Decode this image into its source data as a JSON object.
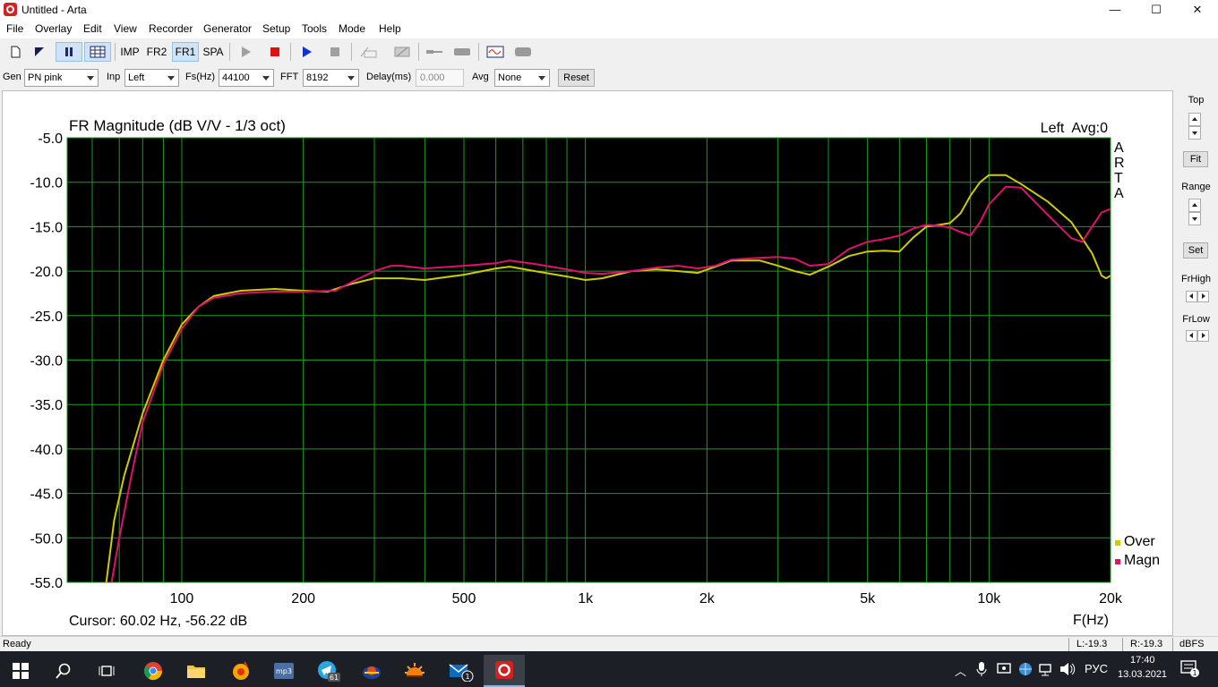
{
  "window": {
    "title": "Untitled - Arta",
    "min_glyph": "—",
    "max_glyph": "☐",
    "close_glyph": "✕"
  },
  "menu": [
    "File",
    "Overlay",
    "Edit",
    "View",
    "Recorder",
    "Generator",
    "Setup",
    "Tools",
    "Mode",
    "Help"
  ],
  "toolbar": {
    "imp": "IMP",
    "fr2": "FR2",
    "fr1": "FR1",
    "spa": "SPA"
  },
  "params": {
    "gen_label": "Gen",
    "gen_value": "PN pink",
    "inp_label": "Inp",
    "inp_value": "Left",
    "fs_label": "Fs(Hz)",
    "fs_value": "44100",
    "fft_label": "FFT",
    "fft_value": "8192",
    "delay_label": "Delay(ms)",
    "delay_value": "0.000",
    "avg_label": "Avg",
    "avg_value": "None",
    "reset_label": "Reset"
  },
  "right_panel": {
    "top": "Top",
    "fit": "Fit",
    "range": "Range",
    "set": "Set",
    "frhigh": "FrHigh",
    "frlow": "FrLow"
  },
  "status": {
    "ready": "Ready",
    "left_level": "L:-19.3",
    "right_level": "R:-19.3",
    "units": "dBFS"
  },
  "taskbar": {
    "time": "17:40",
    "date": "13.03.2021",
    "lang": "РУС",
    "telegram_badge": "61",
    "mail_badge": "1"
  },
  "chart_data": {
    "type": "line",
    "title": "FR Magnitude (dB V/V - 1/3 oct)",
    "channel_info": "Left  Avg:0",
    "watermark": "ARTA",
    "xlabel": "F(Hz)",
    "cursor_readout": "Cursor: 60.02 Hz, -56.22 dB",
    "x_scale": "log",
    "xlim": [
      52,
      20000
    ],
    "ylim": [
      -55,
      -5
    ],
    "grid": true,
    "x_tick_labels": [
      "100",
      "200",
      "500",
      "1k",
      "2k",
      "5k",
      "10k",
      "20k"
    ],
    "x_tick_values": [
      100,
      200,
      500,
      1000,
      2000,
      5000,
      10000,
      20000
    ],
    "y_tick_labels": [
      "-5.0",
      "-10.0",
      "-15.0",
      "-20.0",
      "-25.0",
      "-30.0",
      "-35.0",
      "-40.0",
      "-45.0",
      "-50.0",
      "-55.0"
    ],
    "y_tick_values": [
      -5,
      -10,
      -15,
      -20,
      -25,
      -30,
      -35,
      -40,
      -45,
      -50,
      -55
    ],
    "legend_position": "bottom-right",
    "series": [
      {
        "name": "Over",
        "color": "#cccc00",
        "points": [
          [
            65,
            -55
          ],
          [
            68,
            -48
          ],
          [
            72,
            -43
          ],
          [
            80,
            -36
          ],
          [
            90,
            -30
          ],
          [
            100,
            -26
          ],
          [
            110,
            -24
          ],
          [
            120,
            -22.8
          ],
          [
            140,
            -22.2
          ],
          [
            170,
            -22
          ],
          [
            200,
            -22.2
          ],
          [
            230,
            -22.3
          ],
          [
            260,
            -21.5
          ],
          [
            300,
            -20.8
          ],
          [
            350,
            -20.8
          ],
          [
            400,
            -21
          ],
          [
            500,
            -20.4
          ],
          [
            600,
            -19.7
          ],
          [
            650,
            -19.5
          ],
          [
            750,
            -20
          ],
          [
            900,
            -20.6
          ],
          [
            1000,
            -21
          ],
          [
            1100,
            -20.8
          ],
          [
            1300,
            -20
          ],
          [
            1500,
            -19.8
          ],
          [
            1700,
            -20
          ],
          [
            1900,
            -20.2
          ],
          [
            2100,
            -19.5
          ],
          [
            2300,
            -18.8
          ],
          [
            2700,
            -18.8
          ],
          [
            3000,
            -19.4
          ],
          [
            3300,
            -20
          ],
          [
            3600,
            -20.4
          ],
          [
            4000,
            -19.5
          ],
          [
            4500,
            -18.3
          ],
          [
            5000,
            -17.8
          ],
          [
            5500,
            -17.7
          ],
          [
            6000,
            -17.8
          ],
          [
            6500,
            -16.2
          ],
          [
            7000,
            -15
          ],
          [
            7500,
            -14.8
          ],
          [
            8000,
            -14.6
          ],
          [
            8500,
            -13.5
          ],
          [
            9000,
            -11.5
          ],
          [
            9500,
            -10
          ],
          [
            10000,
            -9.2
          ],
          [
            11000,
            -9.2
          ],
          [
            12000,
            -10.2
          ],
          [
            14000,
            -12.2
          ],
          [
            16000,
            -14.5
          ],
          [
            18000,
            -18
          ],
          [
            19000,
            -20.5
          ],
          [
            19500,
            -20.8
          ],
          [
            20000,
            -20.5
          ]
        ]
      },
      {
        "name": "Magn",
        "color": "#e0106e",
        "points": [
          [
            67,
            -55
          ],
          [
            70,
            -50
          ],
          [
            75,
            -43
          ],
          [
            80,
            -37
          ],
          [
            90,
            -30.5
          ],
          [
            100,
            -26.5
          ],
          [
            110,
            -24
          ],
          [
            120,
            -23
          ],
          [
            140,
            -22.5
          ],
          [
            170,
            -22.3
          ],
          [
            200,
            -22.3
          ],
          [
            240,
            -22.2
          ],
          [
            270,
            -21
          ],
          [
            300,
            -20
          ],
          [
            330,
            -19.4
          ],
          [
            350,
            -19.4
          ],
          [
            400,
            -19.7
          ],
          [
            500,
            -19.4
          ],
          [
            600,
            -19.1
          ],
          [
            650,
            -18.8
          ],
          [
            750,
            -19.2
          ],
          [
            900,
            -19.8
          ],
          [
            1000,
            -20.2
          ],
          [
            1100,
            -20.3
          ],
          [
            1300,
            -20
          ],
          [
            1500,
            -19.6
          ],
          [
            1700,
            -19.4
          ],
          [
            1900,
            -19.7
          ],
          [
            2100,
            -19.4
          ],
          [
            2300,
            -18.7
          ],
          [
            2700,
            -18.5
          ],
          [
            3000,
            -18.4
          ],
          [
            3300,
            -18.6
          ],
          [
            3600,
            -19.4
          ],
          [
            4000,
            -19.2
          ],
          [
            4500,
            -17.5
          ],
          [
            5000,
            -16.7
          ],
          [
            5500,
            -16.4
          ],
          [
            6000,
            -16
          ],
          [
            6500,
            -15.2
          ],
          [
            7000,
            -14.8
          ],
          [
            7500,
            -14.9
          ],
          [
            8000,
            -15.1
          ],
          [
            8500,
            -15.6
          ],
          [
            9000,
            -16
          ],
          [
            9500,
            -14.5
          ],
          [
            10000,
            -12.5
          ],
          [
            11000,
            -10.5
          ],
          [
            12000,
            -10.6
          ],
          [
            14000,
            -13.7
          ],
          [
            16000,
            -16.3
          ],
          [
            17000,
            -16.7
          ],
          [
            18000,
            -15
          ],
          [
            19000,
            -13.4
          ],
          [
            20000,
            -13
          ]
        ]
      }
    ]
  }
}
